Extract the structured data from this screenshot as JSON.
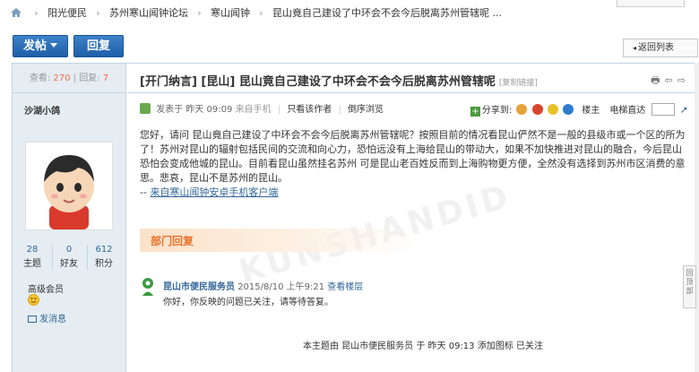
{
  "breadcrumb": {
    "items": [
      "阳光便民",
      "苏州寒山闻钟论坛",
      "寒山闻钟",
      "昆山竟自己建设了中环会不会今后脱离苏州管辖呢 ..."
    ]
  },
  "toolbar": {
    "post_label": "发帖",
    "reply_label": "回复",
    "back_label": "返回列表"
  },
  "sidebar": {
    "views_label": "查看:",
    "views": "270",
    "sep": "|",
    "replies_label": "回复:",
    "replies": "7",
    "username": "沙湖小鸽",
    "counts": [
      {
        "num": "28",
        "label": "主题"
      },
      {
        "num": "0",
        "label": "好友"
      },
      {
        "num": "612",
        "label": "积分"
      }
    ],
    "level": "高级会员",
    "message_label": "发消息"
  },
  "thread": {
    "title": "[开门纳言] [昆山] 昆山竟自己建设了中环会不会今后脱离苏州管辖呢",
    "copy_link": "[复制链接]",
    "title_icons": "🖶⇦⇨",
    "meta": {
      "posted": "发表于 昨天 09:09",
      "from": "来自手机",
      "author_only": "只看该作者",
      "reverse": "倒序浏览"
    },
    "meta_right": {
      "share": "分享到:",
      "floor": "楼主",
      "jump": "电梯直达"
    },
    "body": "您好，请问 昆山竟自己建设了中环会不会今后脱离苏州管辖呢？按照目前的情况看昆山俨然不是一般的县级市或一个区的所为了！苏州对昆山的辐射包括民间的交流和向心力，恐怕远没有上海给昆山的带动大，如果不加快推进对昆山的融合，今后昆山恐怕会变成他城的昆山。目前看昆山虽然挂名苏州 可是昆山老百姓反而到上海购物更方便，全然没有选择到苏州市区消费的意思。悲哀，昆山不是苏州的昆山。",
    "source_prefix": "-- ",
    "source_link": "来自寒山闻钟安卓手机客户端",
    "watermark": "KUNSHANDID"
  },
  "reply_section": {
    "banner": "部门回复",
    "who": "昆山市便民服务员",
    "date": "2015/8/10 上午9:21",
    "view": "查看楼层",
    "text": "你好，你反映的问题已关注，请等待答复。"
  },
  "mod_note": "本主题由 昆山市便民服务员 于 昨天 09:13 添加图标 已关注",
  "back_top": "回顶部"
}
